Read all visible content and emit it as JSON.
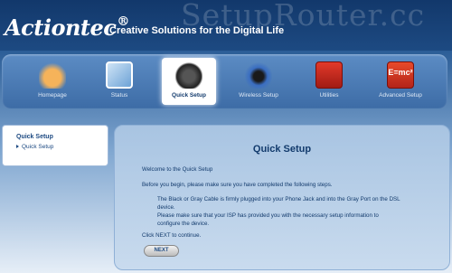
{
  "brand": {
    "logo_text": "Actiontec",
    "tagline": "Creative Solutions for the Digital Life",
    "watermark": "SetupRouter.cc"
  },
  "nav": {
    "items": [
      {
        "label": "Homepage",
        "icon": "house-icon"
      },
      {
        "label": "Status",
        "icon": "status-screen-icon"
      },
      {
        "label": "Quick Setup",
        "icon": "quick-setup-icon",
        "active": true
      },
      {
        "label": "Wireless Setup",
        "icon": "wireless-router-icon"
      },
      {
        "label": "Utilities",
        "icon": "toolbox-icon"
      },
      {
        "label": "Advanced Setup",
        "icon": "emc2-icon"
      }
    ]
  },
  "sidebar": {
    "heading": "Quick Setup",
    "items": [
      {
        "label": "Quick Setup"
      }
    ]
  },
  "main": {
    "title": "Quick Setup",
    "welcome": "Welcome to the Quick Setup",
    "intro": "Before you begin, please make sure you have completed the following steps.",
    "step1_line1": "The Black or Gray Cable is firmly plugged into your Phone Jack and into the Gray Port on the DSL",
    "step1_line2": "device.",
    "step2_line1": "Please make sure that your ISP has provided you with the necessary setup information to",
    "step2_line2": "configure the device.",
    "instruction": "Click NEXT to continue.",
    "next_label": "NEXT"
  }
}
